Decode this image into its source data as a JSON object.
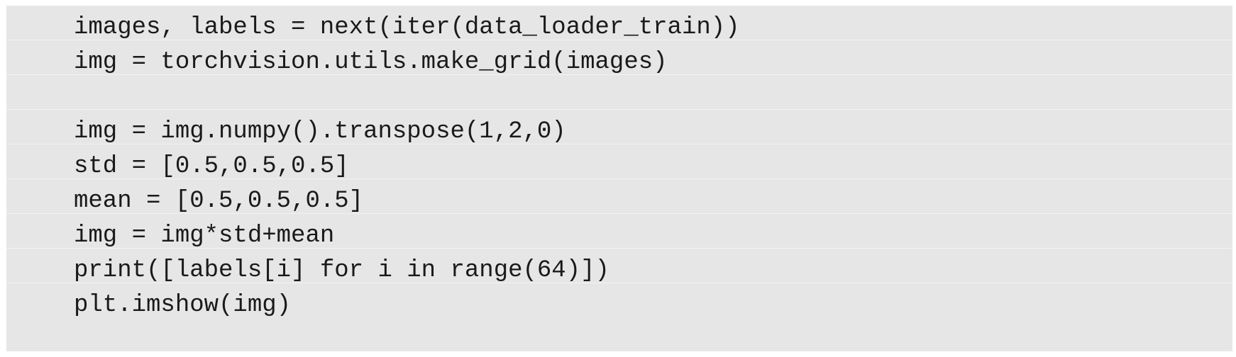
{
  "code": {
    "lines": [
      "images, labels = next(iter(data_loader_train))",
      "img = torchvision.utils.make_grid(images)",
      "",
      "img = img.numpy().transpose(1,2,0)",
      "std = [0.5,0.5,0.5]",
      "mean = [0.5,0.5,0.5]",
      "img = img*std+mean",
      "print([labels[i] for i in range(64)])",
      "plt.imshow(img)"
    ]
  },
  "colors": {
    "background": "#e6e6e6",
    "text": "#1a1a1a"
  }
}
